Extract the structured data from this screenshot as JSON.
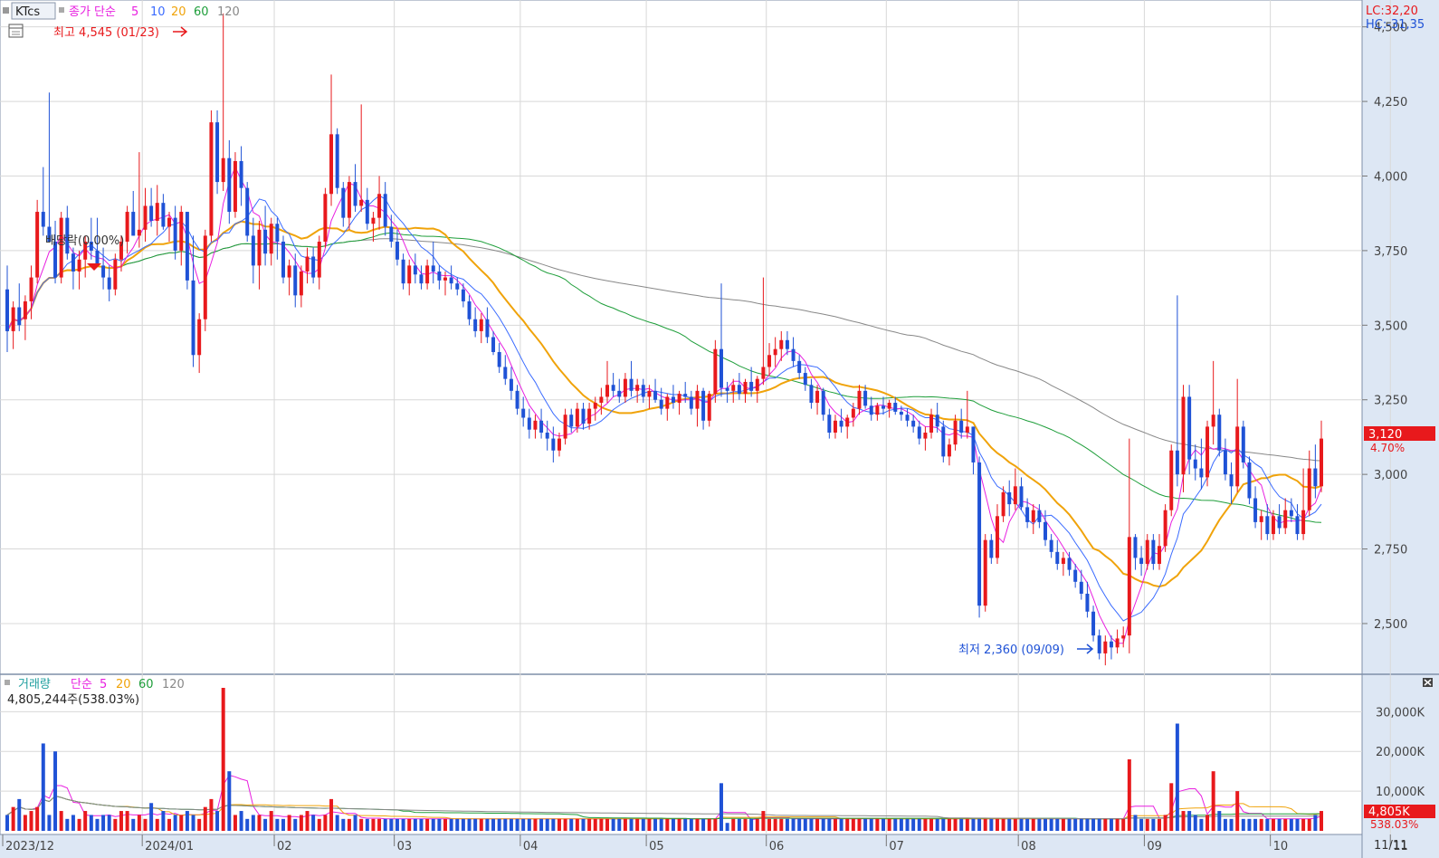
{
  "colors": {
    "up": "#e8191c",
    "down": "#1f52d6",
    "ma5": "#e81fe0",
    "ma10": "#3a6bff",
    "ma20": "#f0a30a",
    "ma60": "#1e9e3a",
    "ma120": "#888888",
    "axis_bg": "#dde7f4",
    "last_bg": "#e8191c"
  },
  "price_legend": {
    "ticker": "KTcs",
    "label": "종가 단순",
    "p1": "5",
    "p2": "10",
    "p3": "20",
    "p4": "60",
    "p5": "120"
  },
  "price_axis": {
    "ticks": [
      "4,500",
      "4,250",
      "4,000",
      "3,750",
      "3,500",
      "3,250",
      "3,000",
      "2,750",
      "2,500"
    ],
    "lc": "LC:32,20",
    "hc": "HC:-31,35",
    "last": "3,120",
    "last_pct": "4.70%"
  },
  "annotations": {
    "max": "최고 4,545 (01/23)",
    "min": "최저 2,360 (09/09)",
    "dividend": "배당락(0.00%)"
  },
  "volume_legend": {
    "label": "거래량",
    "method": "단순",
    "p1": "5",
    "p2": "20",
    "p3": "60",
    "p4": "120",
    "current": "4,805,244주(538.03%)"
  },
  "volume_axis": {
    "ticks": [
      "30,000K",
      "20,000K",
      "10,000K"
    ],
    "last": "4,805K",
    "last_pct": "538.03%"
  },
  "time_axis": {
    "labels": [
      "2023/12",
      "2024/01",
      "02",
      "03",
      "04",
      "05",
      "06",
      "07",
      "08",
      "09",
      "10",
      "11"
    ],
    "end": "11/11"
  },
  "chart_data": {
    "type": "candlestick",
    "title": "KTcs",
    "y_axis": {
      "range": [
        2330,
        4590
      ],
      "ticks": [
        4500,
        4250,
        4000,
        3750,
        3500,
        3250,
        3000,
        2750,
        2500
      ]
    },
    "x_axis": {
      "months": [
        "2023/12",
        "2024/01",
        "02",
        "03",
        "04",
        "05",
        "06",
        "07",
        "08",
        "09",
        "10",
        "11"
      ]
    },
    "summary": {
      "high": 4545,
      "high_date": "01/23",
      "low": 2360,
      "low_date": "09/09",
      "last_close": 3120,
      "last_change_pct": 4.7,
      "last_volume": 4805244,
      "volume_ratio_pct": 538.03
    },
    "candles": [
      [
        3620,
        3700,
        3410,
        3480
      ],
      [
        3480,
        3580,
        3420,
        3560
      ],
      [
        3560,
        3640,
        3480,
        3500
      ],
      [
        3520,
        3600,
        3450,
        3580
      ],
      [
        3580,
        3700,
        3520,
        3660
      ],
      [
        3660,
        3920,
        3640,
        3880
      ],
      [
        3880,
        4030,
        3800,
        3830
      ],
      [
        3830,
        4280,
        3780,
        3780
      ],
      [
        3780,
        3850,
        3640,
        3660
      ],
      [
        3660,
        3880,
        3640,
        3860
      ],
      [
        3860,
        3900,
        3720,
        3740
      ],
      [
        3740,
        3760,
        3620,
        3680
      ],
      [
        3680,
        3750,
        3620,
        3720
      ],
      [
        3720,
        3800,
        3660,
        3780
      ],
      [
        3780,
        3860,
        3720,
        3750
      ],
      [
        3750,
        3860,
        3700,
        3700
      ],
      [
        3700,
        3760,
        3620,
        3660
      ],
      [
        3660,
        3700,
        3580,
        3620
      ],
      [
        3620,
        3740,
        3600,
        3720
      ],
      [
        3720,
        3800,
        3680,
        3780
      ],
      [
        3780,
        3900,
        3740,
        3880
      ],
      [
        3880,
        3950,
        3800,
        3800
      ],
      [
        3800,
        4080,
        3760,
        3820
      ],
      [
        3820,
        3960,
        3780,
        3900
      ],
      [
        3900,
        3960,
        3830,
        3850
      ],
      [
        3850,
        3970,
        3800,
        3910
      ],
      [
        3910,
        3940,
        3820,
        3830
      ],
      [
        3830,
        3880,
        3780,
        3860
      ],
      [
        3860,
        3900,
        3720,
        3750
      ],
      [
        3750,
        3900,
        3700,
        3880
      ],
      [
        3880,
        3880,
        3620,
        3650
      ],
      [
        3650,
        3800,
        3360,
        3400
      ],
      [
        3400,
        3540,
        3340,
        3520
      ],
      [
        3520,
        3820,
        3480,
        3800
      ],
      [
        3800,
        4220,
        3780,
        4180
      ],
      [
        4180,
        4220,
        3940,
        3980
      ],
      [
        3980,
        4545,
        3950,
        4060
      ],
      [
        4060,
        4120,
        3840,
        3880
      ],
      [
        3880,
        4080,
        3860,
        4050
      ],
      [
        4050,
        4100,
        3900,
        3960
      ],
      [
        3960,
        3980,
        3780,
        3800
      ],
      [
        3800,
        3860,
        3640,
        3700
      ],
      [
        3700,
        3850,
        3620,
        3820
      ],
      [
        3820,
        3900,
        3700,
        3740
      ],
      [
        3740,
        3860,
        3700,
        3840
      ],
      [
        3840,
        3860,
        3720,
        3780
      ],
      [
        3780,
        3800,
        3640,
        3660
      ],
      [
        3660,
        3720,
        3600,
        3700
      ],
      [
        3700,
        3740,
        3560,
        3600
      ],
      [
        3600,
        3700,
        3560,
        3680
      ],
      [
        3680,
        3760,
        3640,
        3730
      ],
      [
        3730,
        3760,
        3640,
        3660
      ],
      [
        3660,
        3800,
        3620,
        3780
      ],
      [
        3780,
        3960,
        3760,
        3940
      ],
      [
        3940,
        4340,
        3900,
        4140
      ],
      [
        4140,
        4160,
        3940,
        3960
      ],
      [
        3960,
        3980,
        3830,
        3860
      ],
      [
        3860,
        4000,
        3820,
        3980
      ],
      [
        3980,
        4040,
        3880,
        3900
      ],
      [
        3900,
        4240,
        3880,
        3920
      ],
      [
        3920,
        3960,
        3820,
        3840
      ],
      [
        3840,
        3880,
        3780,
        3860
      ],
      [
        3860,
        4000,
        3820,
        3940
      ],
      [
        3940,
        3980,
        3800,
        3830
      ],
      [
        3830,
        3870,
        3760,
        3780
      ],
      [
        3780,
        3820,
        3700,
        3720
      ],
      [
        3720,
        3740,
        3620,
        3640
      ],
      [
        3640,
        3720,
        3600,
        3700
      ],
      [
        3700,
        3740,
        3640,
        3670
      ],
      [
        3670,
        3700,
        3620,
        3640
      ],
      [
        3640,
        3720,
        3620,
        3700
      ],
      [
        3700,
        3780,
        3640,
        3680
      ],
      [
        3680,
        3700,
        3620,
        3650
      ],
      [
        3650,
        3680,
        3600,
        3660
      ],
      [
        3660,
        3700,
        3620,
        3640
      ],
      [
        3640,
        3660,
        3600,
        3620
      ],
      [
        3620,
        3640,
        3560,
        3580
      ],
      [
        3580,
        3600,
        3500,
        3520
      ],
      [
        3520,
        3560,
        3460,
        3480
      ],
      [
        3480,
        3540,
        3440,
        3520
      ],
      [
        3520,
        3560,
        3440,
        3460
      ],
      [
        3460,
        3480,
        3400,
        3410
      ],
      [
        3410,
        3440,
        3340,
        3360
      ],
      [
        3360,
        3400,
        3300,
        3320
      ],
      [
        3320,
        3360,
        3250,
        3280
      ],
      [
        3280,
        3300,
        3200,
        3220
      ],
      [
        3220,
        3260,
        3160,
        3190
      ],
      [
        3190,
        3220,
        3120,
        3150
      ],
      [
        3150,
        3200,
        3120,
        3180
      ],
      [
        3180,
        3220,
        3120,
        3140
      ],
      [
        3140,
        3180,
        3080,
        3120
      ],
      [
        3120,
        3160,
        3040,
        3080
      ],
      [
        3080,
        3140,
        3060,
        3120
      ],
      [
        3120,
        3220,
        3100,
        3200
      ],
      [
        3200,
        3220,
        3140,
        3160
      ],
      [
        3160,
        3240,
        3140,
        3220
      ],
      [
        3220,
        3240,
        3150,
        3170
      ],
      [
        3170,
        3240,
        3150,
        3220
      ],
      [
        3220,
        3260,
        3180,
        3240
      ],
      [
        3240,
        3290,
        3200,
        3260
      ],
      [
        3260,
        3380,
        3240,
        3300
      ],
      [
        3300,
        3340,
        3260,
        3280
      ],
      [
        3280,
        3320,
        3240,
        3260
      ],
      [
        3260,
        3340,
        3240,
        3320
      ],
      [
        3320,
        3380,
        3260,
        3280
      ],
      [
        3280,
        3320,
        3240,
        3300
      ],
      [
        3300,
        3320,
        3240,
        3260
      ],
      [
        3260,
        3300,
        3220,
        3280
      ],
      [
        3280,
        3320,
        3240,
        3250
      ],
      [
        3250,
        3290,
        3200,
        3220
      ],
      [
        3220,
        3270,
        3180,
        3260
      ],
      [
        3260,
        3300,
        3220,
        3240
      ],
      [
        3240,
        3280,
        3200,
        3270
      ],
      [
        3270,
        3310,
        3240,
        3260
      ],
      [
        3260,
        3280,
        3200,
        3220
      ],
      [
        3220,
        3300,
        3160,
        3280
      ],
      [
        3280,
        3290,
        3150,
        3180
      ],
      [
        3180,
        3280,
        3160,
        3270
      ],
      [
        3270,
        3450,
        3240,
        3420
      ],
      [
        3420,
        3640,
        3260,
        3290
      ],
      [
        3290,
        3310,
        3240,
        3280
      ],
      [
        3280,
        3320,
        3240,
        3300
      ],
      [
        3300,
        3340,
        3250,
        3270
      ],
      [
        3270,
        3320,
        3240,
        3310
      ],
      [
        3310,
        3360,
        3260,
        3280
      ],
      [
        3280,
        3330,
        3240,
        3320
      ],
      [
        3320,
        3660,
        3300,
        3360
      ],
      [
        3360,
        3440,
        3330,
        3400
      ],
      [
        3400,
        3460,
        3360,
        3420
      ],
      [
        3420,
        3480,
        3380,
        3450
      ],
      [
        3450,
        3480,
        3400,
        3420
      ],
      [
        3420,
        3460,
        3360,
        3380
      ],
      [
        3380,
        3400,
        3320,
        3340
      ],
      [
        3340,
        3360,
        3280,
        3300
      ],
      [
        3300,
        3320,
        3220,
        3240
      ],
      [
        3240,
        3300,
        3200,
        3280
      ],
      [
        3280,
        3290,
        3180,
        3200
      ],
      [
        3200,
        3220,
        3120,
        3140
      ],
      [
        3140,
        3200,
        3120,
        3180
      ],
      [
        3180,
        3220,
        3140,
        3160
      ],
      [
        3160,
        3200,
        3120,
        3190
      ],
      [
        3190,
        3240,
        3160,
        3220
      ],
      [
        3220,
        3300,
        3200,
        3280
      ],
      [
        3280,
        3300,
        3220,
        3230
      ],
      [
        3230,
        3260,
        3180,
        3200
      ],
      [
        3200,
        3240,
        3180,
        3230
      ],
      [
        3230,
        3260,
        3200,
        3220
      ],
      [
        3220,
        3250,
        3190,
        3240
      ],
      [
        3240,
        3260,
        3200,
        3210
      ],
      [
        3210,
        3230,
        3180,
        3200
      ],
      [
        3200,
        3220,
        3160,
        3180
      ],
      [
        3180,
        3200,
        3140,
        3160
      ],
      [
        3160,
        3180,
        3100,
        3120
      ],
      [
        3120,
        3160,
        3080,
        3140
      ],
      [
        3140,
        3220,
        3120,
        3200
      ],
      [
        3200,
        3240,
        3140,
        3160
      ],
      [
        3160,
        3180,
        3040,
        3060
      ],
      [
        3060,
        3120,
        3030,
        3100
      ],
      [
        3100,
        3200,
        3080,
        3180
      ],
      [
        3180,
        3220,
        3120,
        3140
      ],
      [
        3140,
        3280,
        3120,
        3160
      ],
      [
        3160,
        3160,
        3000,
        3040
      ],
      [
        3040,
        3060,
        2520,
        2560
      ],
      [
        2560,
        2800,
        2540,
        2780
      ],
      [
        2780,
        2800,
        2700,
        2720
      ],
      [
        2720,
        2900,
        2700,
        2860
      ],
      [
        2860,
        2960,
        2840,
        2940
      ],
      [
        2940,
        2980,
        2860,
        2900
      ],
      [
        2900,
        3020,
        2880,
        2960
      ],
      [
        2960,
        2990,
        2880,
        2890
      ],
      [
        2890,
        2920,
        2820,
        2840
      ],
      [
        2840,
        2900,
        2800,
        2880
      ],
      [
        2880,
        2900,
        2820,
        2840
      ],
      [
        2840,
        2880,
        2760,
        2780
      ],
      [
        2780,
        2800,
        2720,
        2740
      ],
      [
        2740,
        2780,
        2680,
        2700
      ],
      [
        2700,
        2740,
        2660,
        2720
      ],
      [
        2720,
        2740,
        2660,
        2680
      ],
      [
        2680,
        2700,
        2620,
        2640
      ],
      [
        2640,
        2680,
        2580,
        2600
      ],
      [
        2600,
        2640,
        2520,
        2540
      ],
      [
        2540,
        2560,
        2440,
        2460
      ],
      [
        2460,
        2480,
        2380,
        2400
      ],
      [
        2400,
        2460,
        2360,
        2440
      ],
      [
        2440,
        2460,
        2380,
        2420
      ],
      [
        2420,
        2480,
        2400,
        2450
      ],
      [
        2450,
        2490,
        2420,
        2460
      ],
      [
        2460,
        3120,
        2400,
        2790
      ],
      [
        2790,
        2800,
        2680,
        2720
      ],
      [
        2720,
        2760,
        2660,
        2700
      ],
      [
        2700,
        2800,
        2680,
        2780
      ],
      [
        2780,
        2800,
        2680,
        2700
      ],
      [
        2700,
        2800,
        2680,
        2760
      ],
      [
        2760,
        2900,
        2740,
        2880
      ],
      [
        2880,
        3100,
        2860,
        3080
      ],
      [
        3080,
        3600,
        2960,
        3000
      ],
      [
        3000,
        3300,
        2940,
        3260
      ],
      [
        3260,
        3300,
        3000,
        3050
      ],
      [
        3050,
        3100,
        2980,
        3020
      ],
      [
        3020,
        3120,
        2950,
        2990
      ],
      [
        2990,
        3180,
        2960,
        3160
      ],
      [
        3160,
        3380,
        3100,
        3200
      ],
      [
        3200,
        3220,
        3060,
        3080
      ],
      [
        3080,
        3120,
        2980,
        3000
      ],
      [
        3000,
        3040,
        2900,
        2960
      ],
      [
        2960,
        3320,
        2940,
        3160
      ],
      [
        3160,
        3180,
        3020,
        3040
      ],
      [
        3040,
        3060,
        2900,
        2920
      ],
      [
        2920,
        2960,
        2820,
        2840
      ],
      [
        2840,
        2880,
        2780,
        2860
      ],
      [
        2860,
        2900,
        2780,
        2800
      ],
      [
        2800,
        2880,
        2780,
        2860
      ],
      [
        2860,
        2900,
        2800,
        2820
      ],
      [
        2820,
        2920,
        2800,
        2880
      ],
      [
        2880,
        2920,
        2840,
        2860
      ],
      [
        2860,
        2900,
        2780,
        2800
      ],
      [
        2800,
        3020,
        2780,
        2880
      ],
      [
        2880,
        3080,
        2860,
        3020
      ],
      [
        3020,
        3100,
        2920,
        2960
      ],
      [
        2960,
        3180,
        2940,
        3120
      ]
    ],
    "volume": [
      4,
      6,
      8,
      4,
      5,
      6,
      22,
      4,
      20,
      5,
      3,
      4,
      3,
      5,
      4,
      3,
      4,
      4,
      3,
      5,
      5,
      3,
      4,
      3,
      7,
      3,
      5,
      3,
      4,
      4,
      5,
      4,
      3,
      6,
      8,
      5,
      36,
      15,
      4,
      5,
      3,
      4,
      4,
      3,
      5,
      3,
      3,
      4,
      3,
      4,
      5,
      4,
      3,
      4,
      8,
      4,
      3,
      3,
      4,
      3,
      3,
      3,
      3,
      3,
      3,
      3,
      3,
      3,
      3,
      3,
      3,
      3,
      3,
      3,
      3,
      3,
      3,
      3,
      3,
      3,
      3,
      3,
      3,
      3,
      3,
      3,
      3,
      3,
      3,
      3,
      3,
      3,
      3,
      3,
      3,
      3,
      3,
      3,
      3,
      3,
      3,
      3,
      3,
      3,
      3,
      3,
      3,
      3,
      3,
      3,
      3,
      3,
      3,
      3,
      3,
      3,
      3,
      3,
      3,
      12,
      2,
      3,
      3,
      3,
      3,
      3,
      5,
      3,
      3,
      3,
      3,
      3,
      3,
      3,
      3,
      3,
      3,
      3,
      3,
      3,
      3,
      3,
      3,
      3,
      3,
      3,
      3,
      3,
      3,
      3,
      3,
      3,
      3,
      3,
      3,
      3,
      3,
      3,
      3,
      3,
      3,
      3,
      3,
      3,
      3,
      3,
      3,
      3,
      3,
      3,
      3,
      3,
      3,
      3,
      3,
      3,
      3,
      3,
      3,
      3,
      3,
      3,
      3,
      3,
      3,
      3,
      3,
      18,
      4,
      3,
      3,
      3,
      3,
      4,
      12,
      27,
      5,
      5,
      4,
      3,
      4,
      15,
      5,
      3,
      3,
      10,
      3,
      3,
      3,
      3,
      3,
      3,
      3,
      3,
      3,
      3,
      3,
      3,
      4,
      5
    ]
  }
}
